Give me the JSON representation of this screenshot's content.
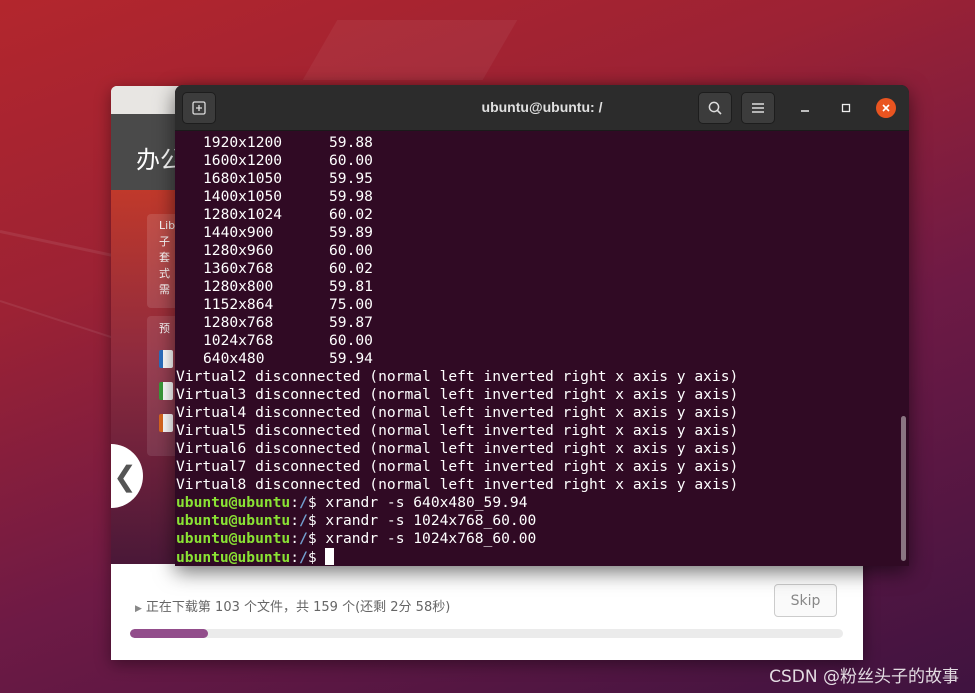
{
  "terminal": {
    "title": "ubuntu@ubuntu: /",
    "modes": [
      {
        "res": "1920x1200",
        "rate": "59.88"
      },
      {
        "res": "1600x1200",
        "rate": "60.00"
      },
      {
        "res": "1680x1050",
        "rate": "59.95"
      },
      {
        "res": "1400x1050",
        "rate": "59.98"
      },
      {
        "res": "1280x1024",
        "rate": "60.02"
      },
      {
        "res": "1440x900",
        "rate": "59.89"
      },
      {
        "res": "1280x960",
        "rate": "60.00"
      },
      {
        "res": "1360x768",
        "rate": "60.02"
      },
      {
        "res": "1280x800",
        "rate": "59.81"
      },
      {
        "res": "1152x864",
        "rate": "75.00"
      },
      {
        "res": "1280x768",
        "rate": "59.87"
      },
      {
        "res": "1024x768",
        "rate": "60.00"
      },
      {
        "res": "640x480",
        "rate": "59.94"
      }
    ],
    "virtual_lines": [
      "Virtual2 disconnected (normal left inverted right x axis y axis)",
      "Virtual3 disconnected (normal left inverted right x axis y axis)",
      "Virtual4 disconnected (normal left inverted right x axis y axis)",
      "Virtual5 disconnected (normal left inverted right x axis y axis)",
      "Virtual6 disconnected (normal left inverted right x axis y axis)",
      "Virtual7 disconnected (normal left inverted right x axis y axis)",
      "Virtual8 disconnected (normal left inverted right x axis y axis)"
    ],
    "prompt_user": "ubuntu@ubuntu",
    "prompt_sep": ":",
    "prompt_path": "/",
    "prompt_symbol": "$ ",
    "commands": [
      "xrandr -s 640x480_59.94",
      "xrandr -s 1024x768_60.00",
      "xrandr -s 1024x768_60.00"
    ],
    "icons": {
      "new_tab": "new-tab-icon",
      "search": "search-icon",
      "menu": "hamburger-menu-icon",
      "minimize": "minimize-icon",
      "maximize": "maximize-icon",
      "close": "close-icon"
    }
  },
  "installer": {
    "hero_title": "办公",
    "card_lines": [
      "Lib",
      "子",
      "套",
      "式",
      "需"
    ],
    "card2_label": "预",
    "status_text": "正在下载第 103 个文件，共 159 个(还剩 2分 58秒)",
    "skip_label": "Skip",
    "progress": 0.11,
    "prev_glyph": "❮"
  },
  "watermark": "CSDN @粉丝头子的故事",
  "colors": {
    "terminal_bg": "#300a24",
    "prompt_user": "#8ae234",
    "prompt_path": "#729fcf",
    "accent_close": "#e95420",
    "progress": "#924d8b"
  }
}
